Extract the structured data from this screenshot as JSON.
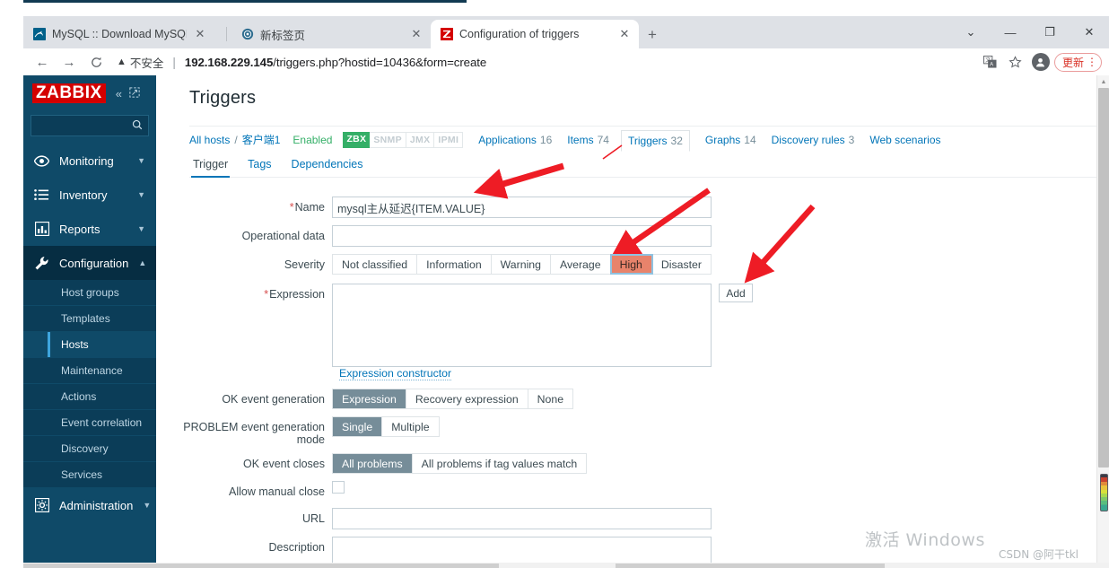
{
  "browser": {
    "tabs": [
      {
        "title": "MySQL :: Download MySQL Co",
        "favicon": "mysql-dolphin-icon",
        "active": false
      },
      {
        "title": "新标签页",
        "favicon": "globe-icon",
        "active": false
      },
      {
        "title": "Configuration of triggers",
        "favicon": "zabbix-z-icon",
        "active": true
      }
    ],
    "new_tab_label": "+",
    "window_controls": {
      "minimize_all": "⌄",
      "minimize": "—",
      "restore": "❐",
      "close": "✕"
    },
    "nav": {
      "back": "←",
      "forward": "→",
      "reload": "⟳"
    },
    "security_label": "不安全",
    "url_host": "192.168.229.145",
    "url_path": "/triggers.php?hostid=10436&form=create",
    "toolbar_icons": [
      "translate-icon",
      "bookmark-star-icon",
      "profile-avatar-icon"
    ],
    "update_label": "更新",
    "kebab_label": "⋮"
  },
  "sidebar": {
    "logo": "ZABBIX",
    "collapse_icon": "double-chevron-left-icon",
    "pin_icon": "collapse-pane-icon",
    "search_placeholder": "",
    "search_value": "",
    "search_icon": "search-icon",
    "items": [
      {
        "label": "Monitoring",
        "icon": "eye-icon",
        "expanded": false
      },
      {
        "label": "Inventory",
        "icon": "list-icon",
        "expanded": false
      },
      {
        "label": "Reports",
        "icon": "bar-chart-icon",
        "expanded": false
      },
      {
        "label": "Configuration",
        "icon": "wrench-icon",
        "expanded": true
      },
      {
        "label": "Administration",
        "icon": "gear-icon",
        "expanded": false
      }
    ],
    "configuration_submenu": [
      {
        "label": "Host groups",
        "active": false
      },
      {
        "label": "Templates",
        "active": false
      },
      {
        "label": "Hosts",
        "active": true
      },
      {
        "label": "Maintenance",
        "active": false
      },
      {
        "label": "Actions",
        "active": false
      },
      {
        "label": "Event correlation",
        "active": false
      },
      {
        "label": "Discovery",
        "active": false
      },
      {
        "label": "Services",
        "active": false
      }
    ]
  },
  "content": {
    "page_title": "Triggers",
    "breadcrumb": {
      "all_hosts": "All hosts",
      "separator": "/",
      "host": "客户端1",
      "status": "Enabled"
    },
    "interface_tags": [
      {
        "label": "ZBX",
        "enabled": true
      },
      {
        "label": "SNMP",
        "enabled": false
      },
      {
        "label": "JMX",
        "enabled": false
      },
      {
        "label": "IPMI",
        "enabled": false
      }
    ],
    "object_nav": [
      {
        "label": "Applications",
        "count": "16",
        "current": false
      },
      {
        "label": "Items",
        "count": "74",
        "current": false
      },
      {
        "label": "Triggers",
        "count": "32",
        "current": true
      },
      {
        "label": "Graphs",
        "count": "14",
        "current": false
      },
      {
        "label": "Discovery rules",
        "count": "3",
        "current": false
      },
      {
        "label": "Web scenarios",
        "count": "",
        "current": false
      }
    ],
    "sub_tabs": [
      {
        "label": "Trigger",
        "active": true
      },
      {
        "label": "Tags",
        "active": false
      },
      {
        "label": "Dependencies",
        "active": false
      }
    ]
  },
  "form": {
    "name": {
      "label": "Name",
      "required": true,
      "value": "mysql主从延迟{ITEM.VALUE}",
      "placeholder": ""
    },
    "operational_data": {
      "label": "Operational data",
      "required": false,
      "value": "",
      "placeholder": ""
    },
    "severity": {
      "label": "Severity",
      "options": [
        "Not classified",
        "Information",
        "Warning",
        "Average",
        "High",
        "Disaster"
      ],
      "selected": "High",
      "selected_color": "#e8836b"
    },
    "expression": {
      "label": "Expression",
      "required": true,
      "value": "",
      "add_button": "Add",
      "constructor_link": "Expression constructor"
    },
    "ok_event_generation": {
      "label": "OK event generation",
      "options": [
        "Expression",
        "Recovery expression",
        "None"
      ],
      "selected": "Expression"
    },
    "problem_event_generation_mode": {
      "label": "PROBLEM event generation mode",
      "options": [
        "Single",
        "Multiple"
      ],
      "selected": "Single"
    },
    "ok_event_closes": {
      "label": "OK event closes",
      "options": [
        "All problems",
        "All problems if tag values match"
      ],
      "selected": "All problems"
    },
    "allow_manual_close": {
      "label": "Allow manual close",
      "checked": false
    },
    "url": {
      "label": "URL",
      "value": "",
      "placeholder": ""
    },
    "description": {
      "label": "Description",
      "value": "",
      "placeholder": ""
    }
  },
  "watermarks": {
    "windows_activation": "激活 Windows",
    "csdn": "CSDN @阿干tkl"
  },
  "annotations": {
    "arrow_color": "#ee1c25",
    "arrows": [
      "arrow-to-name-field",
      "arrow-to-high-severity",
      "arrow-to-add-button"
    ]
  }
}
